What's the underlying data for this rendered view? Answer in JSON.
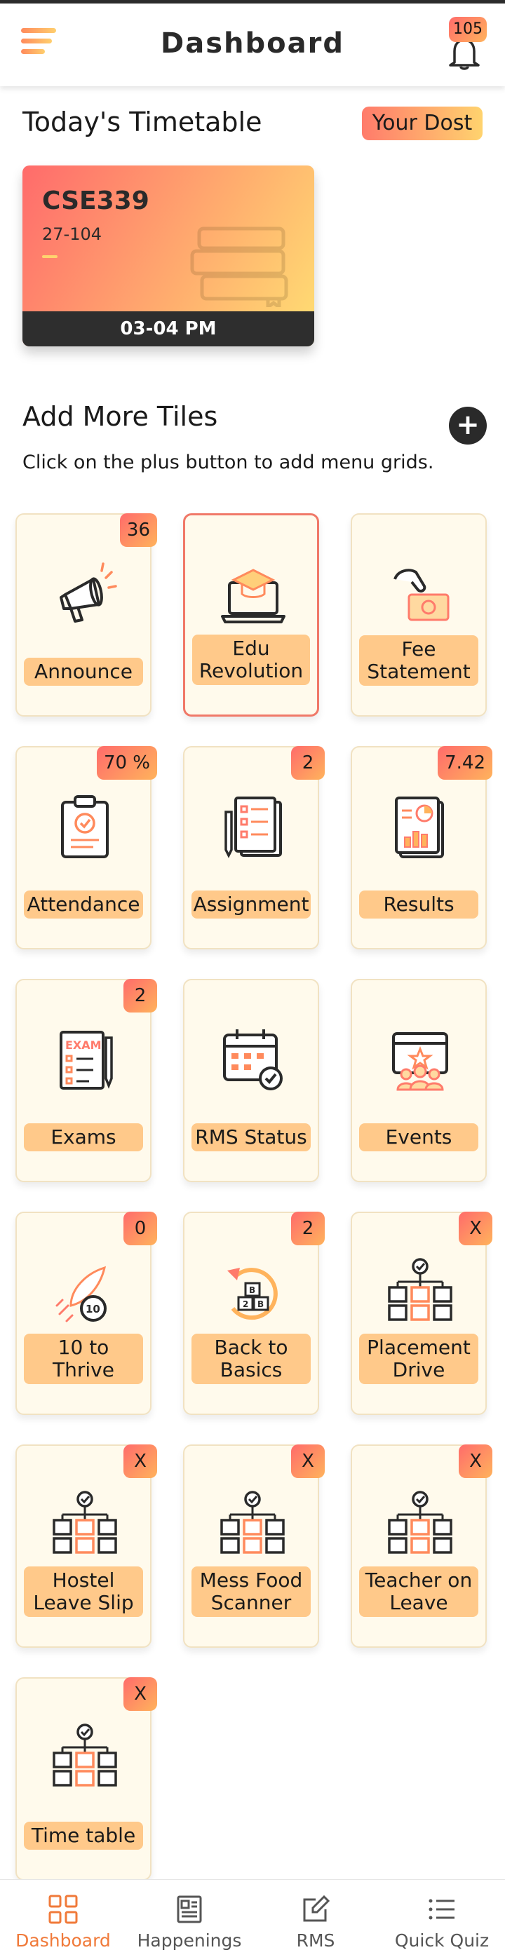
{
  "header": {
    "title": "Dashboard",
    "notification_count": "105"
  },
  "timetable": {
    "title": "Today's Timetable",
    "dost_label": "Your Dost",
    "card": {
      "course": "CSE339",
      "room": "27-104",
      "time": "03-04 PM"
    }
  },
  "tiles_section": {
    "title": "Add More Tiles",
    "subtitle": "Click on the plus button to add menu grids.",
    "plus_label": "+"
  },
  "tiles": [
    {
      "label": "Announce",
      "badge": "36",
      "icon": "megaphone-icon"
    },
    {
      "label": "Edu Revolution",
      "badge": "",
      "icon": "laptop-graduation-icon"
    },
    {
      "label": "Fee Statement",
      "badge": "",
      "icon": "fee-payment-icon"
    },
    {
      "label": "Attendance",
      "badge": "70 %",
      "icon": "clipboard-check-icon"
    },
    {
      "label": "Assignment",
      "badge": "2",
      "icon": "assignment-list-icon"
    },
    {
      "label": "Results",
      "badge": "7.42",
      "icon": "report-chart-icon"
    },
    {
      "label": "Exams",
      "badge": "2",
      "icon": "exam-paper-icon"
    },
    {
      "label": "RMS Status",
      "badge": "",
      "icon": "calendar-check-icon"
    },
    {
      "label": "Events",
      "badge": "",
      "icon": "event-people-icon"
    },
    {
      "label": "10 to Thrive",
      "badge": "0",
      "icon": "rocket-icon"
    },
    {
      "label": "Back to Basics",
      "badge": "2",
      "icon": "back-blocks-icon"
    },
    {
      "label": "Placement Drive",
      "badge": "X",
      "icon": "org-chart-icon"
    },
    {
      "label": "Hostel Leave Slip",
      "badge": "X",
      "icon": "org-chart-icon"
    },
    {
      "label": "Mess Food Scanner",
      "badge": "X",
      "icon": "org-chart-icon"
    },
    {
      "label": "Teacher on Leave",
      "badge": "X",
      "icon": "org-chart-icon"
    },
    {
      "label": "Time table",
      "badge": "X",
      "icon": "org-chart-icon"
    }
  ],
  "bottom_nav": [
    {
      "label": "Dashboard",
      "icon": "grid-icon",
      "active": true
    },
    {
      "label": "Happenings",
      "icon": "newspaper-icon",
      "active": false
    },
    {
      "label": "RMS",
      "icon": "edit-icon",
      "active": false
    },
    {
      "label": "Quick Quiz",
      "icon": "list-icon",
      "active": false
    }
  ],
  "colors": {
    "accent_orange": "#f07a3a",
    "gradient_start": "#ff6b6b",
    "gradient_end": "#ffd36e",
    "tile_bg": "#fffaec",
    "label_bg": "#ffc98a"
  }
}
